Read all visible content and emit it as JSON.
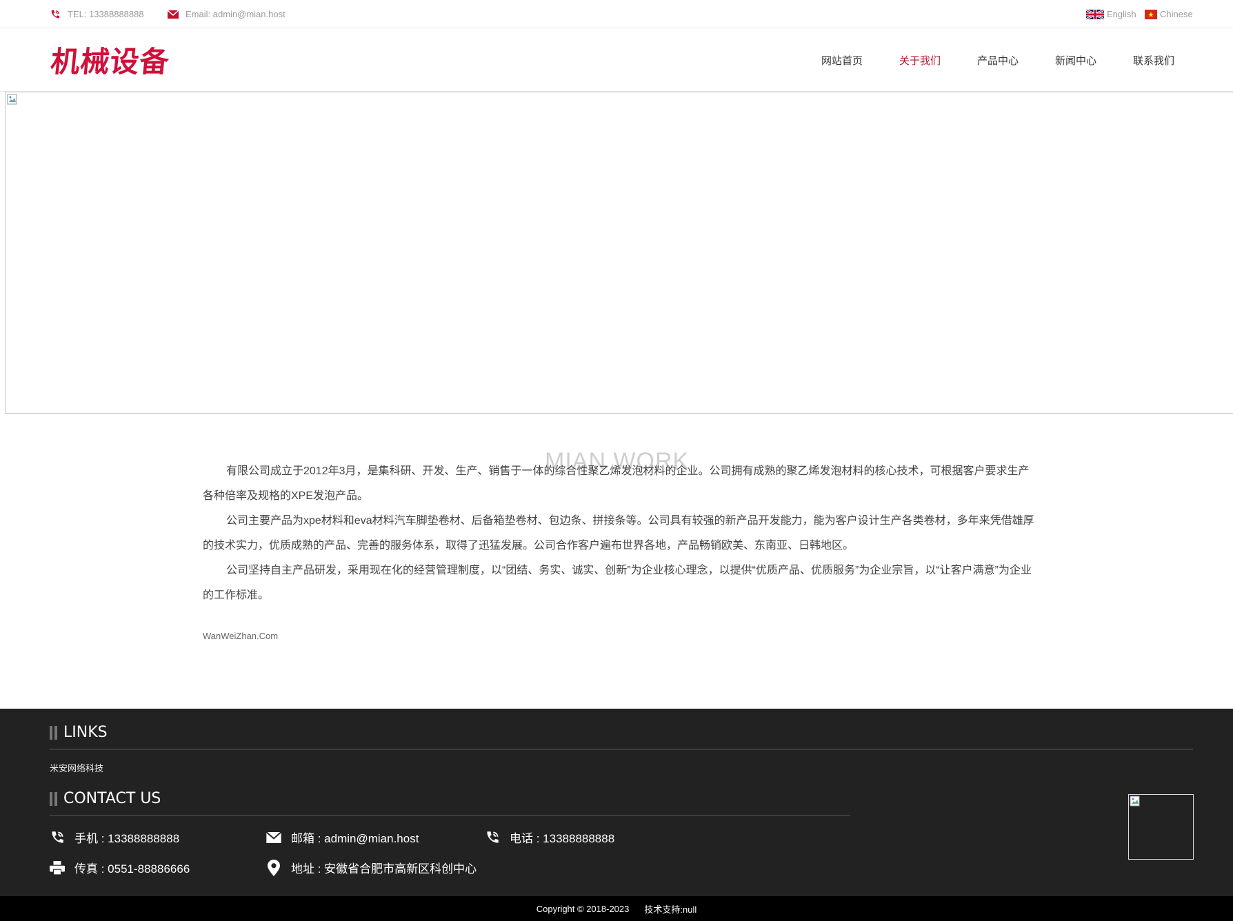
{
  "topbar": {
    "tel": "TEL: 13388888888",
    "email": "Email: admin@mian.host",
    "lang_english": "English",
    "lang_chinese": "Chinese"
  },
  "header": {
    "logo_text": "机械设备",
    "nav": [
      "网站首页",
      "关于我们",
      "产品中心",
      "新闻中心",
      "联系我们"
    ],
    "active_nav": "关于我们"
  },
  "about": {
    "watermark": "MIAN WORK",
    "paragraphs": [
      "有限公司成立于2012年3月，是集科研、开发、生产、销售于一体的综合性聚乙烯发泡材料的企业。公司拥有成熟的聚乙烯发泡材料的核心技术，可根据客户要求生产各种倍率及规格的XPE发泡产品。",
      "公司主要产品为xpe材料和eva材料汽车脚垫卷材、后备箱垫卷材、包边条、拼接条等。公司具有较强的新产品开发能力，能为客户设计生产各类卷材，多年来凭借雄厚的技术实力，优质成熟的产品、完善的服务体系，取得了迅猛发展。公司合作客户遍布世界各地，产品畅销欧美、东南亚、日韩地区。",
      "公司坚持自主产品研发，采用现在化的经营管理制度，以“团结、务实、诚实、创新”为企业核心理念，以提供“优质产品、优质服务”为企业宗旨，以“让客户满意”为企业的工作标准。"
    ],
    "site_link": "WanWeiZhan.Com"
  },
  "footer": {
    "links_title": "LINKS",
    "links": [
      "米安网络科技"
    ],
    "contact_title": "CONTACT US",
    "mobile": "手机 : 13388888888",
    "email": "邮箱 : admin@mian.host",
    "phone": "电话 : 13388888888",
    "fax": "传真 : 0551-88886666",
    "address": "地址 : 安徽省合肥市高新区科创中心"
  },
  "copyright": {
    "text": "Copyright © 2018-2023",
    "support": "技术支持:null"
  },
  "colors": {
    "accent": "#d0103a",
    "nav_active": "#b5142d",
    "footer_bg": "#222222",
    "copyright_bg": "#000000"
  },
  "icons": [
    "phone-icon",
    "mail-icon",
    "uk-flag-icon",
    "vietnam-flag-icon",
    "fax-icon",
    "location-icon",
    "broken-image-icon"
  ]
}
